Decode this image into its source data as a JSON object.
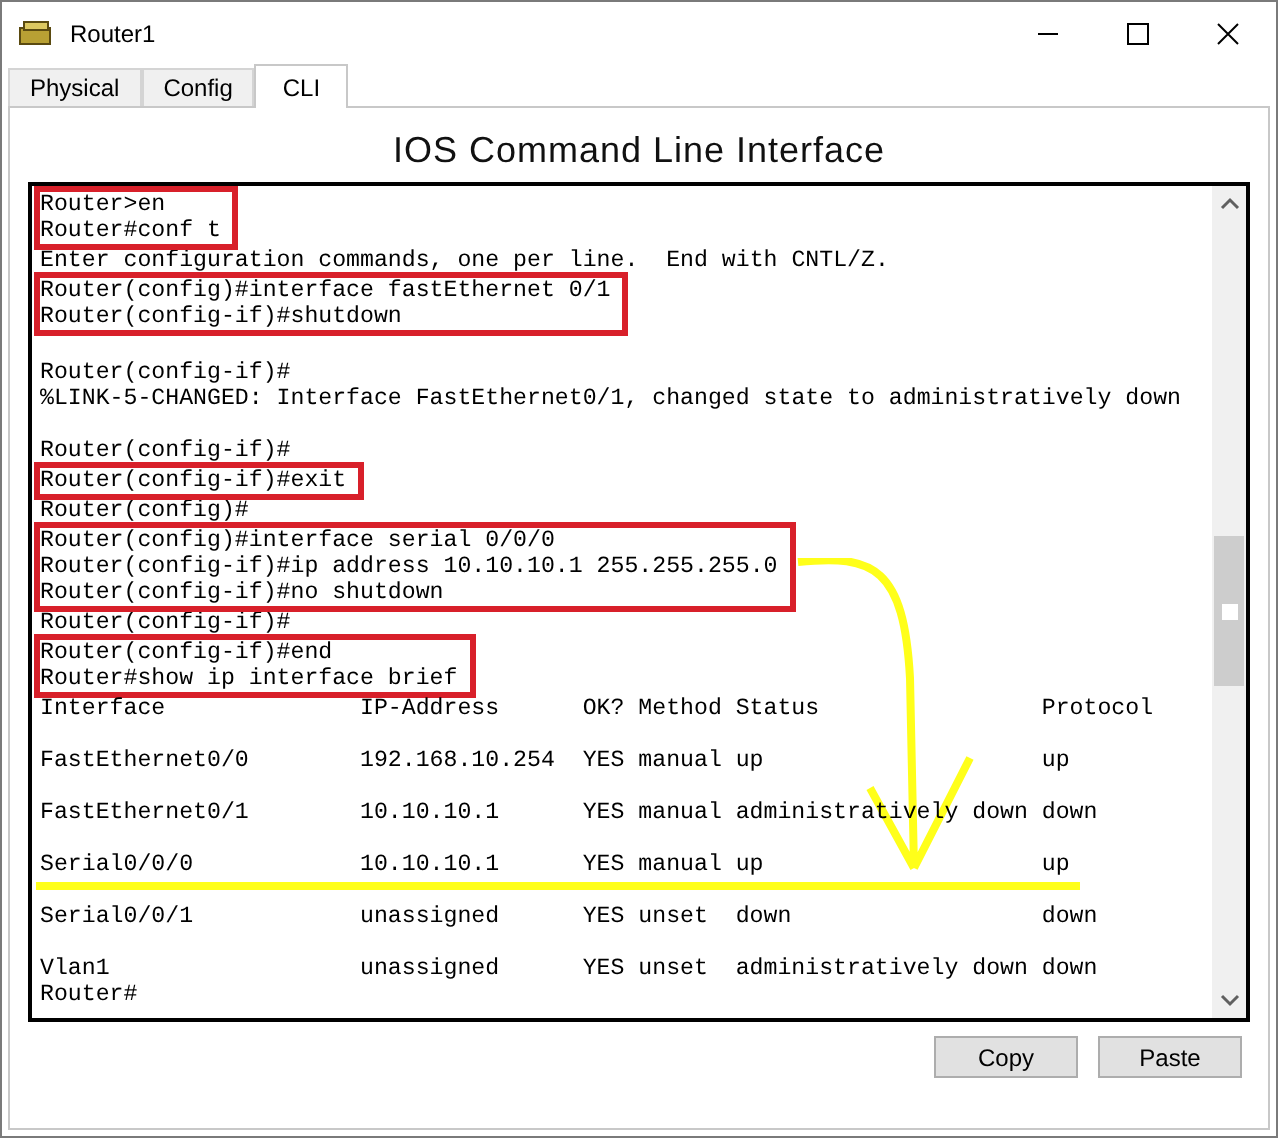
{
  "window": {
    "title": "Router1"
  },
  "tabs": [
    {
      "label": "Physical",
      "selected": false
    },
    {
      "label": "Config",
      "selected": false
    },
    {
      "label": "CLI",
      "selected": true
    }
  ],
  "heading": "IOS Command Line Interface",
  "terminal": [
    {
      "kind": "boxed",
      "lines": [
        "Router>en",
        "Router#conf t"
      ]
    },
    {
      "kind": "text",
      "text": "Enter configuration commands, one per line.  End with CNTL/Z."
    },
    {
      "kind": "boxed",
      "lines": [
        "Router(config)#interface fastEthernet 0/1",
        "Router(config-if)#shutdown"
      ]
    },
    {
      "kind": "blank"
    },
    {
      "kind": "text",
      "text": "Router(config-if)#"
    },
    {
      "kind": "text",
      "text": "%LINK-5-CHANGED: Interface FastEthernet0/1, changed state to administratively down"
    },
    {
      "kind": "blank"
    },
    {
      "kind": "text",
      "text": "Router(config-if)#"
    },
    {
      "kind": "boxed",
      "lines": [
        "Router(config-if)#exit"
      ]
    },
    {
      "kind": "text",
      "text": "Router(config)#"
    },
    {
      "kind": "boxed",
      "lines": [
        "Router(config)#interface serial 0/0/0",
        "Router(config-if)#ip address 10.10.10.1 255.255.255.0",
        "Router(config-if)#no shutdown"
      ],
      "arrow": true
    },
    {
      "kind": "text",
      "text": "Router(config-if)#"
    },
    {
      "kind": "boxed",
      "lines": [
        "Router(config-if)#end",
        "Router#show ip interface brief"
      ]
    },
    {
      "kind": "row",
      "cells": [
        "Interface",
        "IP-Address",
        "OK?",
        "Method",
        "Status",
        "Protocol"
      ]
    },
    {
      "kind": "blank"
    },
    {
      "kind": "row",
      "cells": [
        "FastEthernet0/0",
        "192.168.10.254",
        "YES",
        "manual",
        "up",
        "up"
      ]
    },
    {
      "kind": "blank"
    },
    {
      "kind": "row",
      "cells": [
        "FastEthernet0/1",
        "10.10.10.1",
        "YES",
        "manual",
        "administratively down",
        "down"
      ]
    },
    {
      "kind": "blank"
    },
    {
      "kind": "row",
      "cells": [
        "Serial0/0/0",
        "10.10.10.1",
        "YES",
        "manual",
        "up",
        "up"
      ],
      "underlined": true
    },
    {
      "kind": "blank"
    },
    {
      "kind": "row",
      "cells": [
        "Serial0/0/1",
        "unassigned",
        "YES",
        "unset",
        "down",
        "down"
      ]
    },
    {
      "kind": "blank"
    },
    {
      "kind": "row",
      "cells": [
        "Vlan1",
        "unassigned",
        "YES",
        "unset",
        "administratively down",
        "down"
      ]
    },
    {
      "kind": "text",
      "text": "Router#"
    }
  ],
  "buttons": [
    "Copy",
    "Paste"
  ]
}
